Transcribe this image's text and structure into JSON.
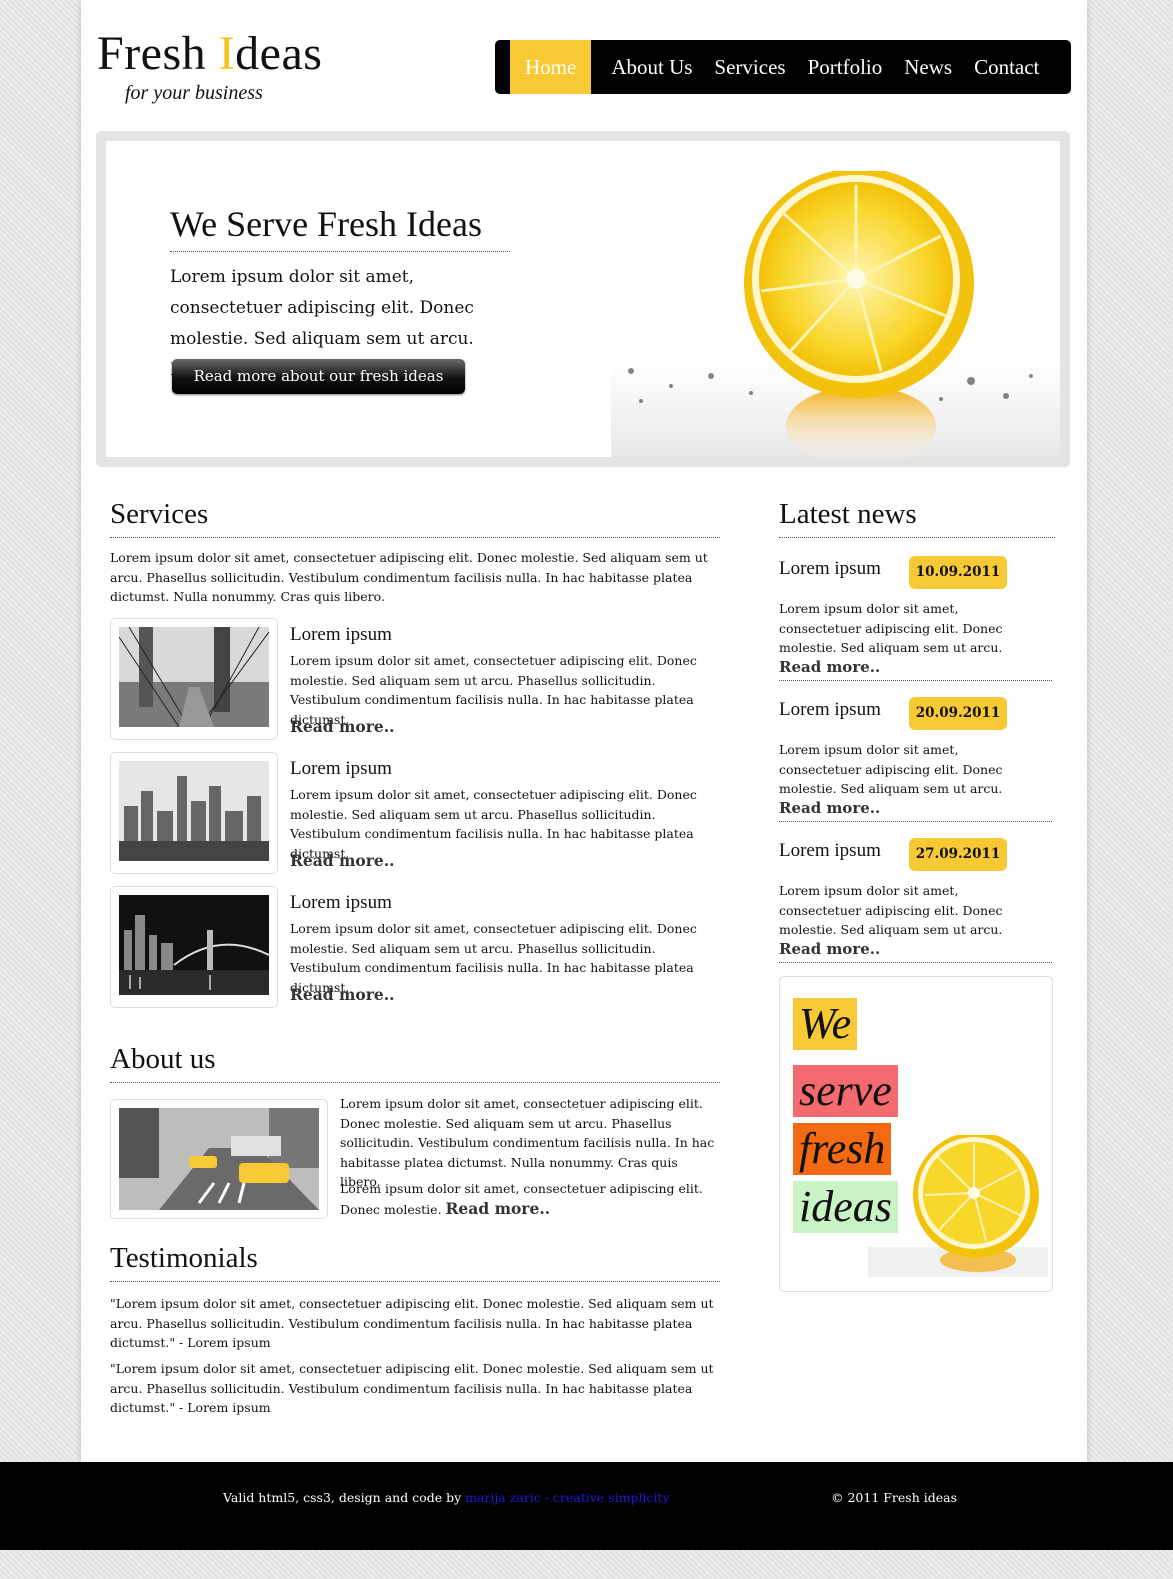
{
  "brand": {
    "logo_pre": "Fresh ",
    "logo_hl": "I",
    "logo_post": "deas",
    "tagline": "for your business",
    "accent": "#f7c934"
  },
  "nav": [
    "Home",
    "About Us",
    "Services",
    "Portfolio",
    "News",
    "Contact"
  ],
  "hero": {
    "title": "We Serve Fresh Ideas",
    "text": "Lorem ipsum dolor sit amet, consectetuer adipiscing elit. Donec molestie. Sed aliquam sem ut arcu. Phasellus sollicitudin.",
    "button": "Read more about our fresh ideas"
  },
  "services": {
    "title": "Services",
    "intro": "Lorem ipsum dolor sit amet, consectetuer adipiscing elit. Donec molestie. Sed aliquam sem ut arcu. Phasellus sollicitudin. Vestibulum condimentum facilisis nulla. In hac habitasse platea dictumst. Nulla nonummy. Cras quis libero.",
    "items": [
      {
        "title": "Lorem ipsum",
        "text": "Lorem ipsum dolor sit amet, consectetuer adipiscing elit. Donec molestie. Sed aliquam sem ut arcu. Phasellus sollicitudin. Vestibulum condimentum facilisis nulla. In hac habitasse platea dictumst.",
        "more": "Read more.."
      },
      {
        "title": "Lorem ipsum",
        "text": "Lorem ipsum dolor sit amet, consectetuer adipiscing elit. Donec molestie. Sed aliquam sem ut arcu. Phasellus sollicitudin. Vestibulum condimentum facilisis nulla. In hac habitasse platea dictumst.",
        "more": "Read more.."
      },
      {
        "title": "Lorem ipsum",
        "text": "Lorem ipsum dolor sit amet, consectetuer adipiscing elit. Donec molestie. Sed aliquam sem ut arcu. Phasellus sollicitudin. Vestibulum condimentum facilisis nulla. In hac habitasse platea dictumst.",
        "more": "Read more.."
      }
    ]
  },
  "about": {
    "title": "About us",
    "p1": "Lorem ipsum dolor sit amet, consectetuer adipiscing elit. Donec molestie. Sed aliquam sem ut arcu. Phasellus sollicitudin. Vestibulum condimentum facilisis nulla. In hac habitasse platea dictumst. Nulla nonummy. Cras quis libero.",
    "p2": "Lorem ipsum dolor sit amet, consectetuer adipiscing elit. Donec molestie.",
    "more": "Read more.."
  },
  "testimonials": {
    "title": "Testimonials",
    "items": [
      "\"Lorem ipsum dolor sit amet, consectetuer adipiscing elit. Donec molestie. Sed aliquam sem ut arcu. Phasellus sollicitudin. Vestibulum condimentum facilisis nulla. In hac habitasse platea dictumst.\" - Lorem ipsum",
      "\"Lorem ipsum dolor sit amet, consectetuer adipiscing elit. Donec molestie. Sed aliquam sem ut arcu. Phasellus sollicitudin. Vestibulum condimentum facilisis nulla. In hac habitasse platea dictumst.\" - Lorem ipsum"
    ]
  },
  "news": {
    "title": "Latest news",
    "items": [
      {
        "title": "Lorem ipsum",
        "date": "10.09.2011",
        "text": "Lorem ipsum dolor sit amet, consectetuer adipiscing elit. Donec molestie. Sed aliquam sem ut arcu. ",
        "more": "Read more.."
      },
      {
        "title": "Lorem ipsum",
        "date": "20.09.2011",
        "text": "Lorem ipsum dolor sit amet, consectetuer adipiscing elit. Donec molestie. Sed aliquam sem ut arcu. ",
        "more": "Read more.."
      },
      {
        "title": "Lorem ipsum",
        "date": "27.09.2011",
        "text": "Lorem ipsum dolor sit amet, consectetuer adipiscing elit. Donec molestie. Sed aliquam sem ut arcu. ",
        "more": "Read more.."
      }
    ]
  },
  "promo": {
    "words": [
      "We",
      "serve",
      "fresh",
      "ideas"
    ],
    "colors": [
      "#f7c934",
      "#f46a6e",
      "#f46a12",
      "#c9f3c4"
    ]
  },
  "footer": {
    "left_text": "Valid html5, css3, design and code by ",
    "left_link": "marija zaric - creative simplicity",
    "right": "© 2011 Fresh ideas"
  }
}
